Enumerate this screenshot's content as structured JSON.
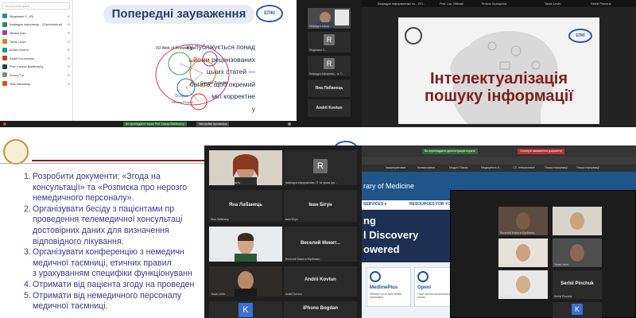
{
  "p1": {
    "search_placeholder": "Find a participant",
    "participants": [
      {
        "name": "Медінкалі С. (Я)",
        "color": "#3a7bd5"
      },
      {
        "name": "Кафедра інформаці... (Організатор)",
        "color": "#2e8b57"
      },
      {
        "name": "Mimka Ivan",
        "color": "#8e44ad"
      },
      {
        "name": "Taras Levin",
        "color": "#e67e22"
      },
      {
        "name": "Andrii Kovtun",
        "color": "#16a085"
      },
      {
        "name": "Andrii Kurnovskyi",
        "color": "#c0392b"
      },
      {
        "name": "Prof. Larysa Babievamy",
        "color": "#2c3e50"
      },
      {
        "name": "Sonny Tul",
        "color": "#7f8c8d"
      },
      {
        "name": "Яна Лабанець",
        "color": "#d35400"
      }
    ],
    "slide_title": "Попередні зауваження",
    "slide_lines": [
      {
        "pre": "ку публікується понад",
        "hl": "",
        "post": ""
      },
      {
        "pre": "",
        "hl": "ьйони",
        "post": " рецензованих"
      },
      {
        "pre": "цьких    статей    —",
        "hl": "",
        "post": ""
      },
      {
        "pre": "багато,  щоб  окремий",
        "hl": "",
        "post": ""
      },
      {
        "pre": "мігі    корректне",
        "hl": "",
        "post": ""
      },
      {
        "pre": "у",
        "hl": "",
        "post": ""
      }
    ],
    "logo_text": "ЕПКІ",
    "graph_labels": {
      "wos": "ISI Web of Knowledge",
      "gs": "Google Scholar",
      "scopus": "Scopus",
      "review": "Review Project"
    },
    "share_banner": "Ви проглядаєте екран Prof. Larysa Babievamy",
    "stop_label": "Настройки просмотра"
  },
  "p2": {
    "tiles": [
      {
        "name": "Кафедра інфор...",
        "letter": "",
        "kind": "video"
      },
      {
        "name": "Медінкалі С...",
        "letter": "R",
        "kind": "letter"
      },
      {
        "name": "Кафедра інформац... в. С...",
        "letter": "R",
        "kind": "letter"
      }
    ],
    "names": [
      "Яна Лабанець",
      "Andrii Kovtun"
    ],
    "small_names": [
      "Яна Лабанець",
      "Andrii Kovtun"
    ]
  },
  "p3": {
    "top_names": [
      "Кафедра інформатики та... ЕП...",
      "Prof. Lar. Mikhail",
      "Тетяна Хрещатик",
      "Taras Levin",
      "Serhii Pinchuk"
    ],
    "title_line1": "Інтелектуалізація",
    "title_line2": "пошуку інформації",
    "logo_text": "ЕПКІ"
  },
  "p4": {
    "logo_text": "ЕПКІ",
    "items": [
      {
        "num": "1.",
        "line": "Розробити    документи:    «Згода    на"
      },
      {
        "num": "",
        "line": "консультації» та «Розписка про нерозго"
      },
      {
        "num": "",
        "line": "немедичного персоналу»."
      },
      {
        "num": "2.",
        "line": "Організувати бесіду з пацієнтами пр"
      },
      {
        "num": "",
        "line": "проведення телемедичної консультаці"
      },
      {
        "num": "",
        "line": "достовірних  даних  для  визначення"
      },
      {
        "num": "",
        "line": "відповідного лікування."
      },
      {
        "num": "3.",
        "line": "Організувати конференцію з немедичн"
      },
      {
        "num": "",
        "line": "медичної   таємниці,   етичних   правил"
      },
      {
        "num": "",
        "line": "з урахуванням специфіки функціонуванн"
      },
      {
        "num": "4.",
        "line": "Отримати від пацієнта згоду на проведен"
      },
      {
        "num": "5.",
        "line": "Отримати  від  немедичного  персоналу"
      },
      {
        "num": "",
        "line": "медичної таємниці."
      }
    ]
  },
  "p5": {
    "tiles": [
      {
        "tname": "Prof. Larysa Babievamy",
        "kind": "face"
      },
      {
        "tname": "Кафедра інформатики, ІТ та проза цін...",
        "kind": "letter",
        "letter": "R",
        "color": "#6b6b6b"
      },
      {
        "tname": "Яна Лабанець",
        "kind": "name",
        "bigname": "Яна Лабанець"
      },
      {
        "tname": "Іван Бігун",
        "kind": "name",
        "bigname": "Іван Бігун"
      },
      {
        "tname": "Катерина Бондар",
        "kind": "face"
      },
      {
        "tname": "Веселий Микита Юрійович",
        "kind": "name",
        "bigname": "Веселий Микит..."
      },
      {
        "tname": "Taras Levin",
        "kind": "face"
      },
      {
        "tname": "Andrii Kovtun",
        "kind": "name",
        "bigname": "Andrii Kovtun"
      },
      {
        "tname": "",
        "kind": "letter",
        "letter": "K",
        "color": "#3a6fd8"
      },
      {
        "tname": "",
        "kind": "name",
        "bigname": "iPhone Bogdan"
      }
    ]
  },
  "p6": {
    "tabs": [
      "Ви переглядаєте демонстрацію екрана",
      "Оглянути заповнення документу"
    ],
    "bookmarks": [
      "Інкорпоративне",
      "Конвертувати",
      "Модулі Пільна",
      "Медицина в Л...",
      "CS. Інтерактивне",
      "Пошук інформації",
      "Пошук інформації"
    ],
    "site_title": "rary of Medicine",
    "nav": [
      "SERVICES ▾",
      "RESOURCES FOR YOU ▾"
    ],
    "hero_lines": [
      "ng",
      "l Discovery",
      "owered"
    ],
    "cards": [
      {
        "title": "MedlinePlus",
        "sub": "Reliable up-to-date health information"
      },
      {
        "title": "Openi",
        "sub": "Open-access biomedical image search"
      }
    ],
    "zoom": {
      "tiles": [
        {
          "tname": "Веселий Микита Юрійович",
          "kind": "face",
          "color": "#7a5b45"
        },
        {
          "tname": "",
          "kind": "face",
          "color": "#c9a27f"
        },
        {
          "tname": "Яна Лабанець",
          "kind": "face",
          "color": "#caa385"
        },
        {
          "tname": "Taras Levin",
          "kind": "face",
          "color": "#8a6a52"
        },
        {
          "tname": "Іван Бігун",
          "kind": "face",
          "color": "#d2b08c"
        },
        {
          "tname": "Serhii Pinchuk",
          "kind": "name",
          "bigname": "Serhii Pinchuk"
        },
        {
          "tname": "",
          "kind": "letter",
          "letter": "K"
        }
      ]
    }
  }
}
